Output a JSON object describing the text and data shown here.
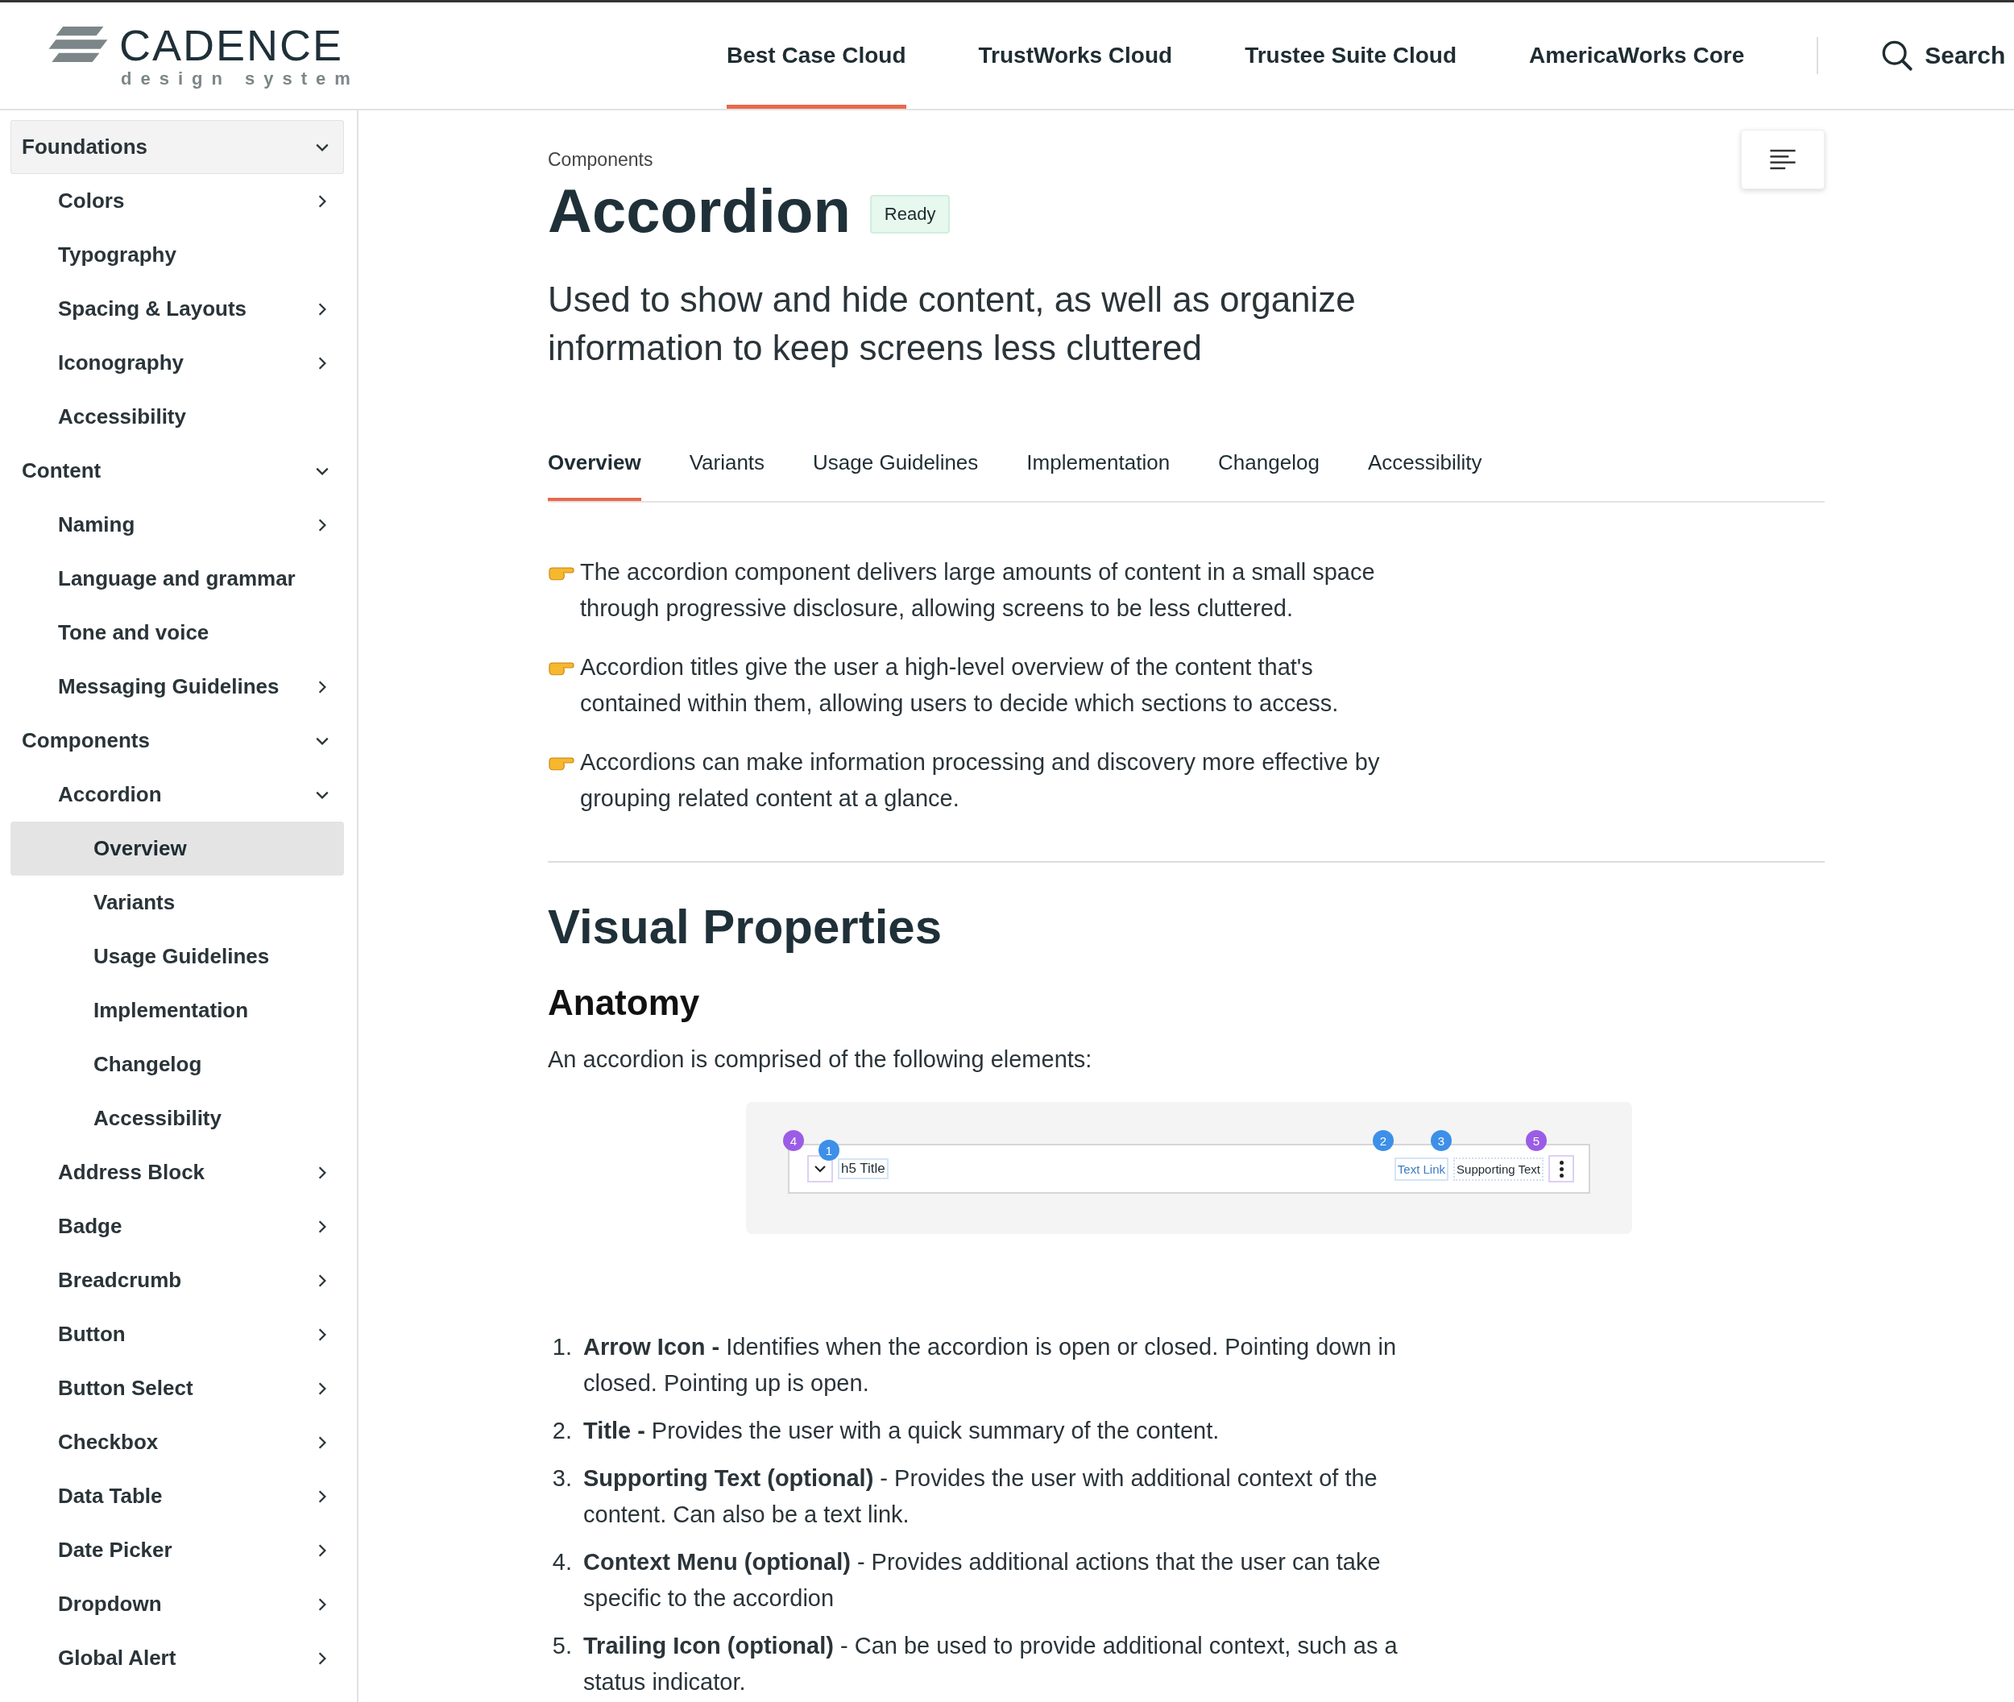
{
  "header": {
    "logo": {
      "name": "CADENCE",
      "tagline": "design system"
    },
    "nav": [
      {
        "label": "Best Case Cloud",
        "selected": true
      },
      {
        "label": "TrustWorks Cloud",
        "selected": false
      },
      {
        "label": "Trustee Suite Cloud",
        "selected": false
      },
      {
        "label": "AmericaWorks Core",
        "selected": false
      }
    ],
    "search": {
      "label": "Search"
    }
  },
  "sidebar": {
    "items": [
      {
        "label": "Foundations",
        "selected": false,
        "hovered": true,
        "expanded": true,
        "children": [
          {
            "label": "Colors",
            "selected": false,
            "expanded": false
          },
          {
            "label": "Typography",
            "selected": false
          },
          {
            "label": "Spacing & Layouts",
            "selected": false,
            "expanded": false
          },
          {
            "label": "Iconography",
            "selected": false,
            "expanded": false
          },
          {
            "label": "Accessibility",
            "selected": false
          }
        ]
      },
      {
        "label": "Content",
        "selected": false,
        "expanded": true,
        "children": [
          {
            "label": "Naming",
            "selected": false,
            "expanded": false
          },
          {
            "label": "Language and grammar",
            "selected": false
          },
          {
            "label": "Tone and voice",
            "selected": false
          },
          {
            "label": "Messaging Guidelines",
            "selected": false,
            "expanded": false
          }
        ]
      },
      {
        "label": "Components",
        "selected": false,
        "expanded": true,
        "children": [
          {
            "label": "Accordion",
            "selected": false,
            "expanded": true,
            "children": [
              {
                "label": "Overview",
                "selected": true
              },
              {
                "label": "Variants",
                "selected": false
              },
              {
                "label": "Usage Guidelines",
                "selected": false
              },
              {
                "label": "Implementation",
                "selected": false
              },
              {
                "label": "Changelog",
                "selected": false
              },
              {
                "label": "Accessibility",
                "selected": false
              }
            ]
          },
          {
            "label": "Address Block",
            "selected": false,
            "expanded": false
          },
          {
            "label": "Badge",
            "selected": false,
            "expanded": false
          },
          {
            "label": "Breadcrumb",
            "selected": false,
            "expanded": false
          },
          {
            "label": "Button",
            "selected": false,
            "expanded": false
          },
          {
            "label": "Button Select",
            "selected": false,
            "expanded": false
          },
          {
            "label": "Checkbox",
            "selected": false,
            "expanded": false
          },
          {
            "label": "Data Table",
            "selected": false,
            "expanded": false
          },
          {
            "label": "Date Picker",
            "selected": false,
            "expanded": false
          },
          {
            "label": "Dropdown",
            "selected": false,
            "expanded": false
          },
          {
            "label": "Global Alert",
            "selected": false,
            "expanded": false
          }
        ]
      }
    ]
  },
  "page": {
    "breadcrumb": "Components",
    "title": "Accordion",
    "status_badge": "Ready",
    "description": "Used to show and hide content, as well as organize information to keep screens less cluttered",
    "tabs": [
      {
        "label": "Overview",
        "selected": true
      },
      {
        "label": "Variants",
        "selected": false
      },
      {
        "label": "Usage Guidelines",
        "selected": false
      },
      {
        "label": "Implementation",
        "selected": false
      },
      {
        "label": "Changelog",
        "selected": false
      },
      {
        "label": "Accessibility",
        "selected": false
      }
    ],
    "intro_points": [
      "The accordion component delivers large amounts of content in a small space through progressive disclosure, allowing screens to be less cluttered.",
      "Accordion titles give the user a high-level overview of the content that's contained within them, allowing users to decide which sections to access.",
      "Accordions can make information processing and discovery more effective by grouping related content at a glance."
    ],
    "section_title": "Visual Properties",
    "subsection_title": "Anatomy",
    "anatomy_intro": "An accordion is comprised of the following elements:",
    "anatomy_diagram": {
      "title": "h5 Title",
      "link": "Text Link",
      "supporting_text": "Supporting Text",
      "markers": [
        {
          "number": "4",
          "color": "#9b5de5"
        },
        {
          "number": "1",
          "color": "#3d8fe8"
        },
        {
          "number": "2",
          "color": "#3d8fe8"
        },
        {
          "number": "3",
          "color": "#3d8fe8"
        },
        {
          "number": "5",
          "color": "#9b5de5"
        }
      ]
    },
    "anatomy_list": [
      {
        "number": "1.",
        "text": "**Arrow Icon -** Identifies when the accordion is open or closed. Pointing down in closed. Pointing up is open."
      },
      {
        "number": "2.",
        "text": "**Title -** Provides the user with a quick summary of the content."
      },
      {
        "number": "3.",
        "text": "**Supporting Text (optional)** - Provides the user with additional context of the content. Can also be a text link."
      },
      {
        "number": "4.",
        "text": "**Context Menu (optional)** - Provides additional actions that the user can take specific to the accordion"
      },
      {
        "number": "5.",
        "text": "**Trailing Icon (optional)** - Can be used to provide additional context, such as a status indicator."
      }
    ]
  }
}
